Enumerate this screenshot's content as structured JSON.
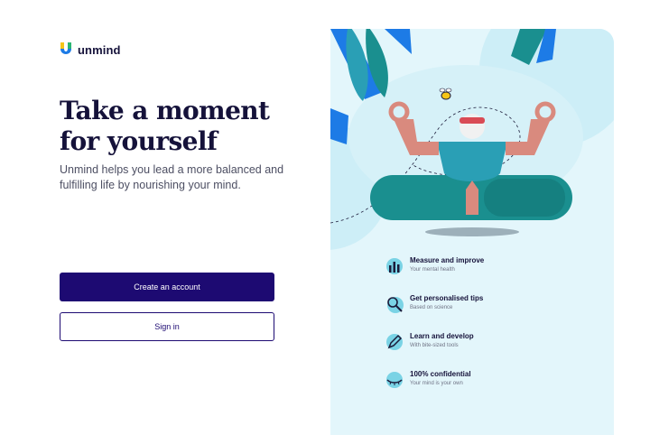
{
  "brand": {
    "name": "unmind"
  },
  "hero": {
    "headline": "Take a moment for yourself",
    "subtitle": "Unmind helps you lead a more balanced and fulfilling life by nourishing your mind."
  },
  "actions": {
    "create_account": "Create an account",
    "sign_in": "Sign in"
  },
  "features": [
    {
      "title": "Measure and improve",
      "subtitle": "Your mental health",
      "icon": "bar-chart-icon"
    },
    {
      "title": "Get personalised tips",
      "subtitle": "Based on science",
      "icon": "magnifier-icon"
    },
    {
      "title": "Learn and develop",
      "subtitle": "With bite-sized tools",
      "icon": "pencil-icon"
    },
    {
      "title": "100% confidential",
      "subtitle": "Your mind is your own",
      "icon": "closed-eye-icon"
    }
  ],
  "colors": {
    "primary": "#1d0a72",
    "panel_background": "#e3f6fb",
    "accent_teal": "#1a8f8f",
    "accent_blue": "#1d7be6",
    "skin": "#d98a7e"
  }
}
